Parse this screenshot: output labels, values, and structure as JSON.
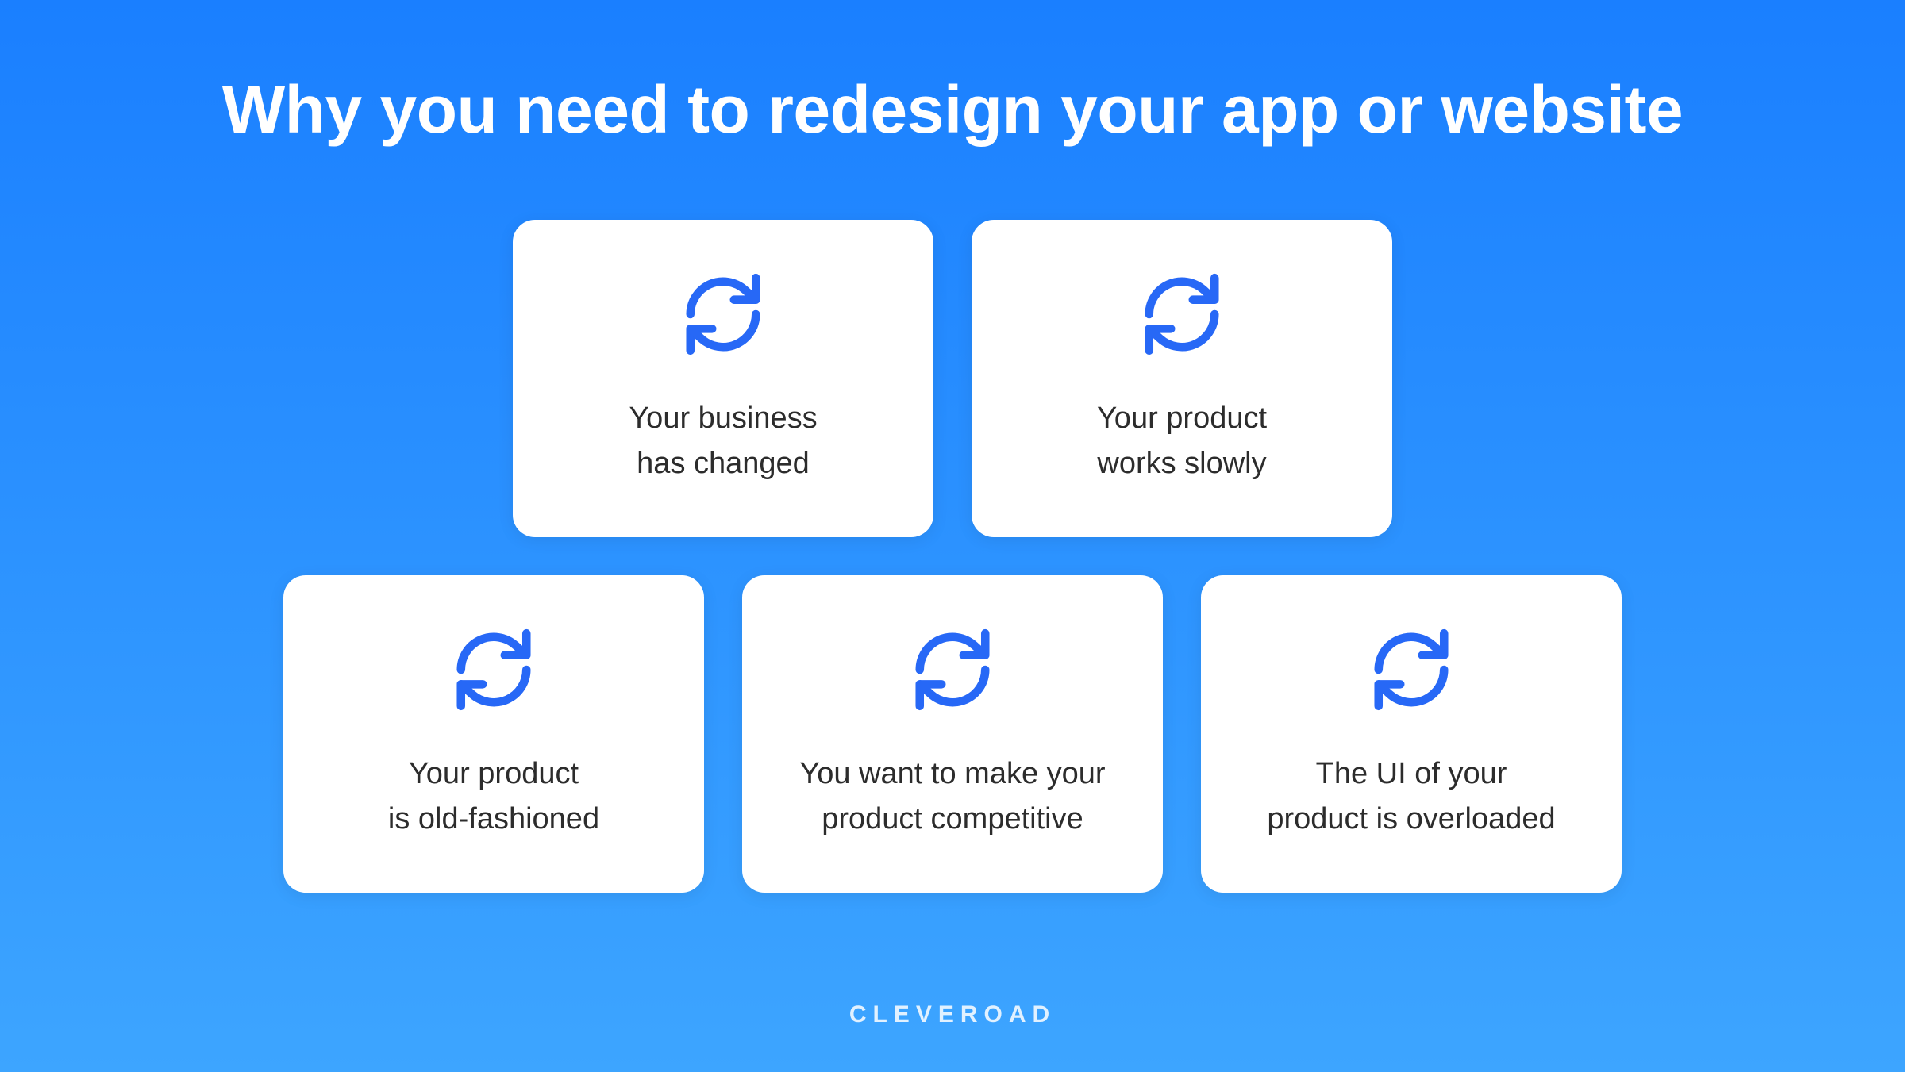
{
  "title": "Why you need to redesign your app or website",
  "cards": {
    "row1": [
      {
        "line1": "Your business",
        "line2": "has changed"
      },
      {
        "line1": "Your product",
        "line2": "works slowly"
      }
    ],
    "row2": [
      {
        "line1": "Your product",
        "line2": "is old-fashioned"
      },
      {
        "line1": "You want to make your",
        "line2": "product competitive"
      },
      {
        "line1": "The UI of your",
        "line2": "product is overloaded"
      }
    ]
  },
  "footer": "CLEVEROAD",
  "colors": {
    "icon": "#2768f6",
    "gradient_start": "#1a7fff",
    "gradient_end": "#3da5ff"
  }
}
